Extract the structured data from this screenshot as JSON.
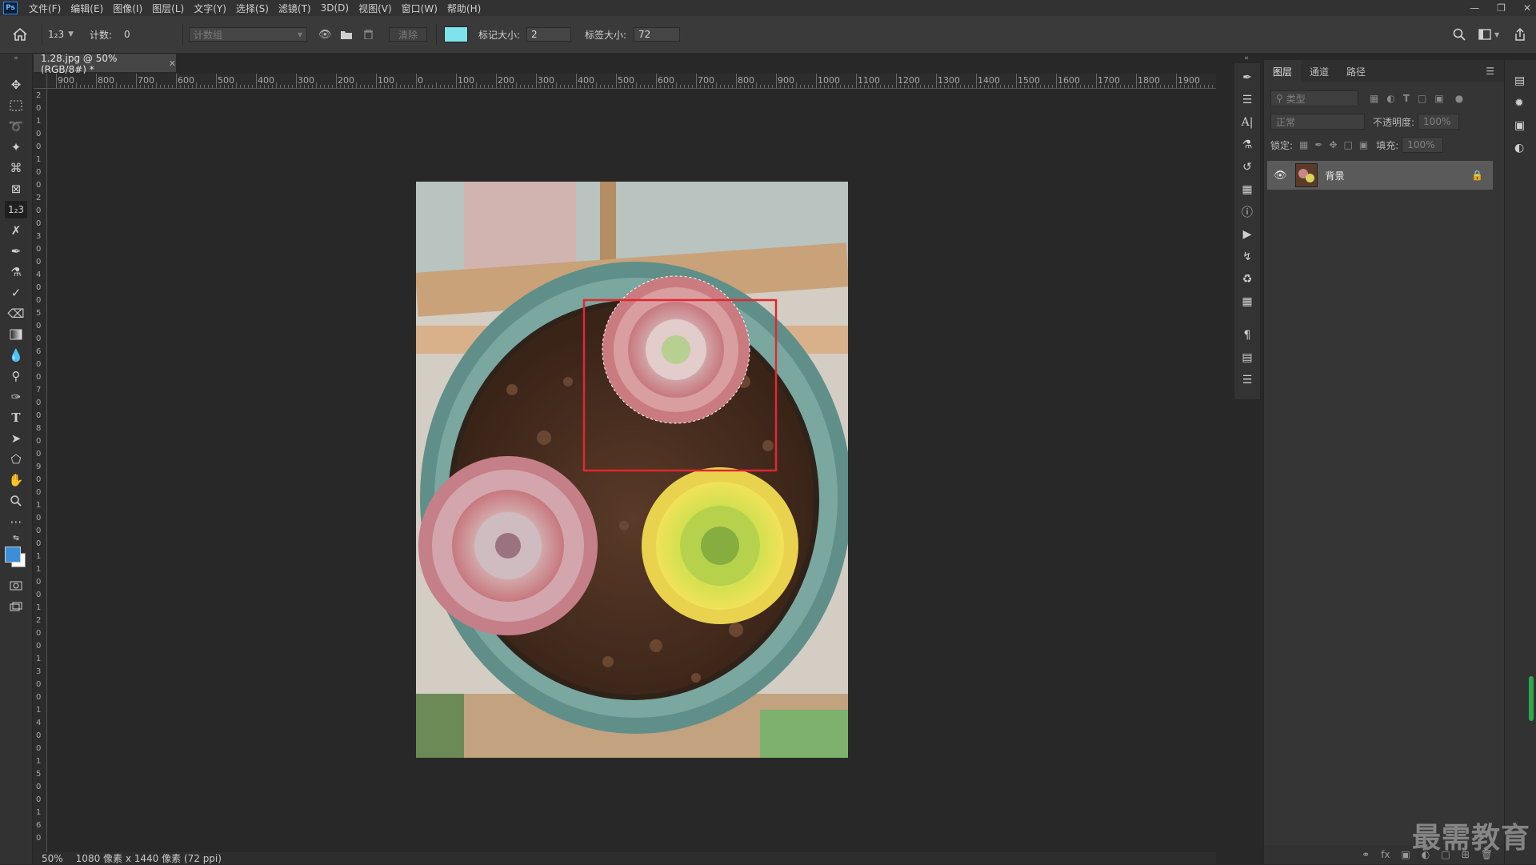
{
  "app": {
    "logo_text": "Ps",
    "menu": [
      "文件(F)",
      "编辑(E)",
      "图像(I)",
      "图层(L)",
      "文字(Y)",
      "选择(S)",
      "滤镜(T)",
      "3D(D)",
      "视图(V)",
      "窗口(W)",
      "帮助(H)"
    ]
  },
  "options_bar": {
    "tool_label": "1₂3",
    "count_label": "计数:",
    "count_value": "0",
    "count_group_placeholder": "计数组",
    "clear_label": "清除",
    "swatch_color": "#7fe3ee",
    "marker_size_label": "标记大小:",
    "marker_size_value": "2",
    "label_size_label": "标签大小:",
    "label_size_value": "72"
  },
  "document": {
    "tab_title": "1.28.jpg @ 50%(RGB/8#) *",
    "status_zoom": "50%",
    "status_info": "1080 像素 x 1440 像素 (72 ppi)"
  },
  "rulers": {
    "top_ticks": [
      "900",
      "800",
      "700",
      "600",
      "500",
      "400",
      "300",
      "200",
      "100",
      "0",
      "100",
      "200",
      "300",
      "400",
      "500",
      "600",
      "700",
      "800",
      "900",
      "1000",
      "1100",
      "1200",
      "1300",
      "1400",
      "1500",
      "1600",
      "1700",
      "1800",
      "1900"
    ],
    "left_ticks": [
      "2",
      "0",
      "1",
      "0",
      "0",
      "1",
      "0",
      "0",
      "2",
      "0",
      "0",
      "3",
      "0",
      "0",
      "4",
      "0",
      "0",
      "5",
      "0",
      "0",
      "6",
      "0",
      "0",
      "7",
      "0",
      "0",
      "8",
      "0",
      "0",
      "9",
      "0",
      "0",
      "1",
      "0",
      "0",
      "0",
      "1",
      "1",
      "0",
      "0",
      "1",
      "2",
      "0",
      "0",
      "1",
      "3",
      "0",
      "0",
      "1",
      "4",
      "0",
      "0",
      "1",
      "5",
      "0",
      "0",
      "1",
      "6",
      "0"
    ]
  },
  "layers_panel": {
    "tabs": [
      "图层",
      "通道",
      "路径"
    ],
    "filter_placeholder": "类型",
    "blend_mode": "正常",
    "opacity_label": "不透明度:",
    "opacity_value": "100%",
    "lock_label": "锁定:",
    "fill_label": "填充:",
    "fill_value": "100%",
    "layer_name": "背景"
  },
  "colors": {
    "foreground": "#3b8fd9",
    "background": "#ffffff",
    "selection_rect": "#e0282f"
  },
  "watermark": "最需教育"
}
